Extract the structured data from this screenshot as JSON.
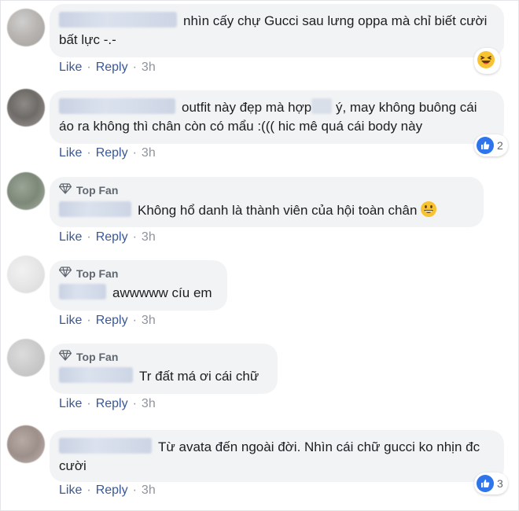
{
  "actions": {
    "like": "Like",
    "reply": "Reply",
    "separator": "·"
  },
  "badge": {
    "top_fan": "Top Fan"
  },
  "comments": [
    {
      "text": "nhìn cấy chự Gucci sau lưng oppa mà chỉ biết cười bất lực -.-",
      "time": "3h",
      "reaction": "haha-icon"
    },
    {
      "text_a": "outfit này đẹp mà hợp",
      "text_b": "ý, may không buông cái áo ra không thì chân còn có mẩu :((( hic mê quá cái body này",
      "time": "3h",
      "reaction_count": "2"
    },
    {
      "text": "Không hổ danh là thành viên của hội toàn chân",
      "time": "3h",
      "emoji": "grinning-emoji"
    },
    {
      "text": "awwwww cíu em",
      "time": "3h"
    },
    {
      "text": "Tr đất má ơi cái chữ",
      "time": "3h"
    },
    {
      "text": "Từ avata đến ngoài đời. Nhìn cái chữ gucci ko nhịn đc cười",
      "time": "3h",
      "reaction_count": "3"
    }
  ],
  "colors": {
    "link": "#385898",
    "bubble": "#f2f3f5",
    "like_blue": "#2e75ec",
    "meta_gray": "#90949c"
  }
}
